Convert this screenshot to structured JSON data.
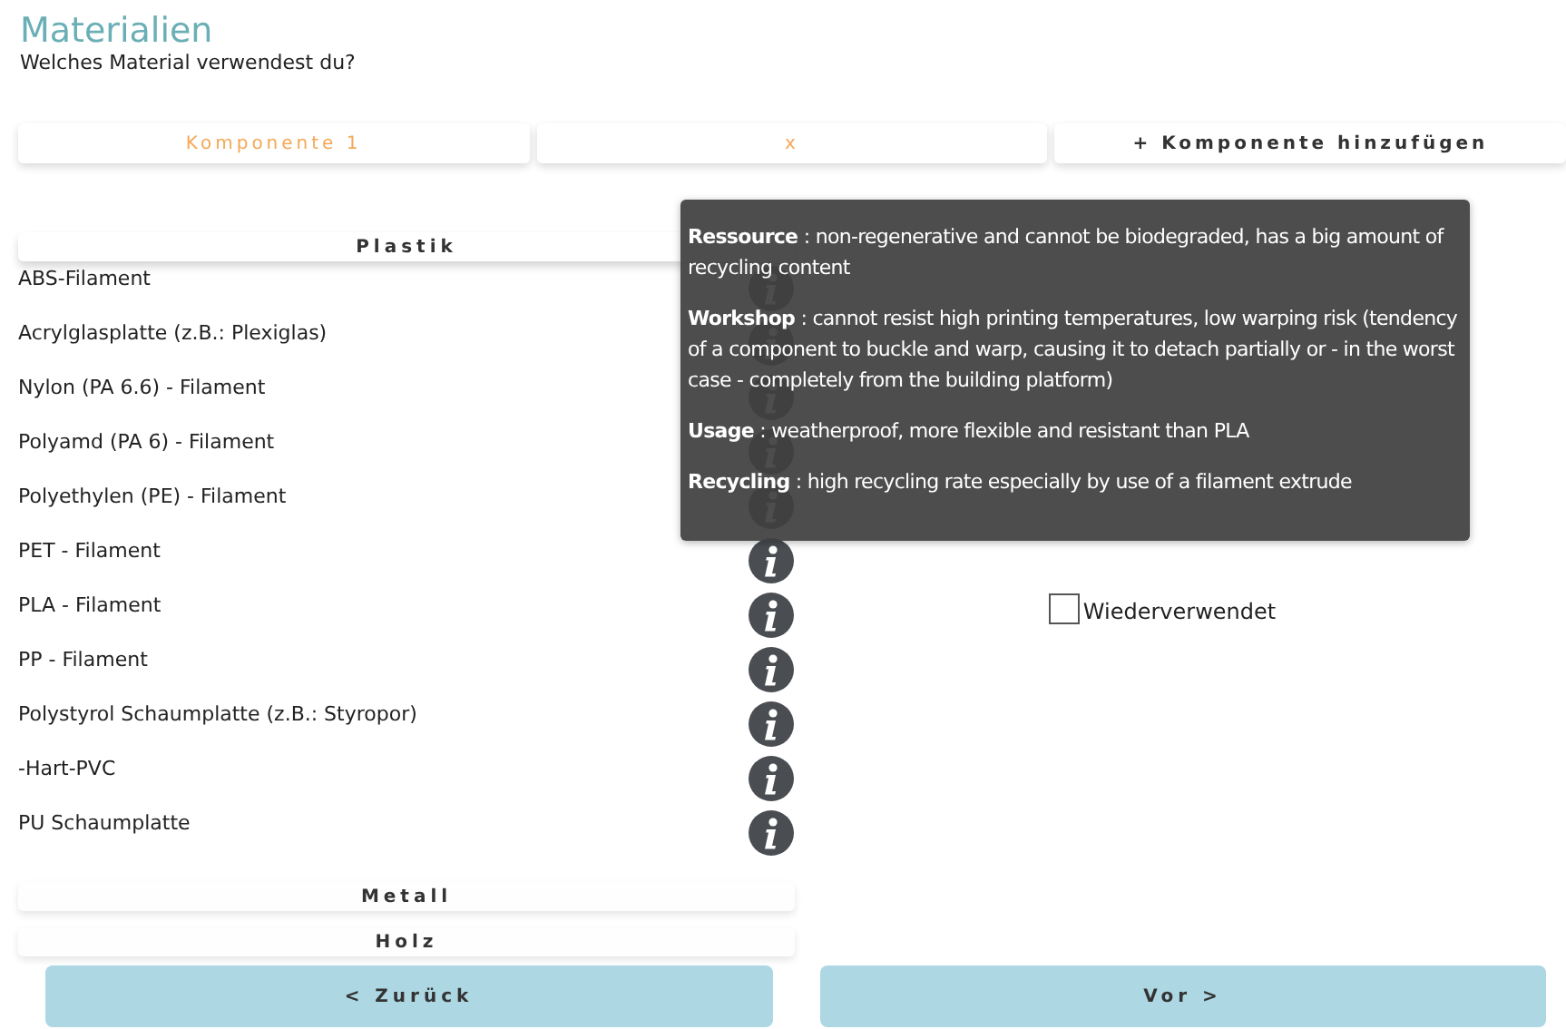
{
  "title": "Materialien",
  "subtitle": "Welches Material verwendest du?",
  "tabs": [
    {
      "label": "Komponente 1",
      "selected": true
    }
  ],
  "remove_button": "x",
  "add_button": "+ Komponente hinzufügen",
  "categories": [
    {
      "title": "Plastik",
      "expanded": true,
      "items": [
        "ABS-Filament",
        "Acrylglasplatte (z.B.: Plexiglas)",
        "Nylon (PA 6.6) - Filament",
        "Polyamd (PA 6) - Filament",
        "Polyethylen (PE) - Filament",
        "PET - Filament",
        "PLA - Filament",
        "PP - Filament",
        "Polystyrol Schaumplatte (z.B.: Styropor)",
        "-Hart-PVC",
        "PU Schaumplatte"
      ]
    },
    {
      "title": "Metall",
      "expanded": false
    },
    {
      "title": "Holz",
      "expanded": false
    }
  ],
  "tooltip": [
    "**Ressource** : non-regenerative and cannot be biodegraded, has a big amount of recycling content",
    "**Workshop** : cannot resist high printing temperatures, low warping risk (tendency of a component to buckle and warp, causing it to detach partially or - in the worst case - completely from the building platform)",
    "**Usage** : weatherproof, more flexible and resistant than PLA",
    "**Recycling** : high recycling rate especially by use of a filament extrude"
  ],
  "reused": {
    "label": "Wiederverwendet",
    "checked": false
  },
  "buttons": {
    "back": "< Zurück",
    "next": "Vor >"
  }
}
